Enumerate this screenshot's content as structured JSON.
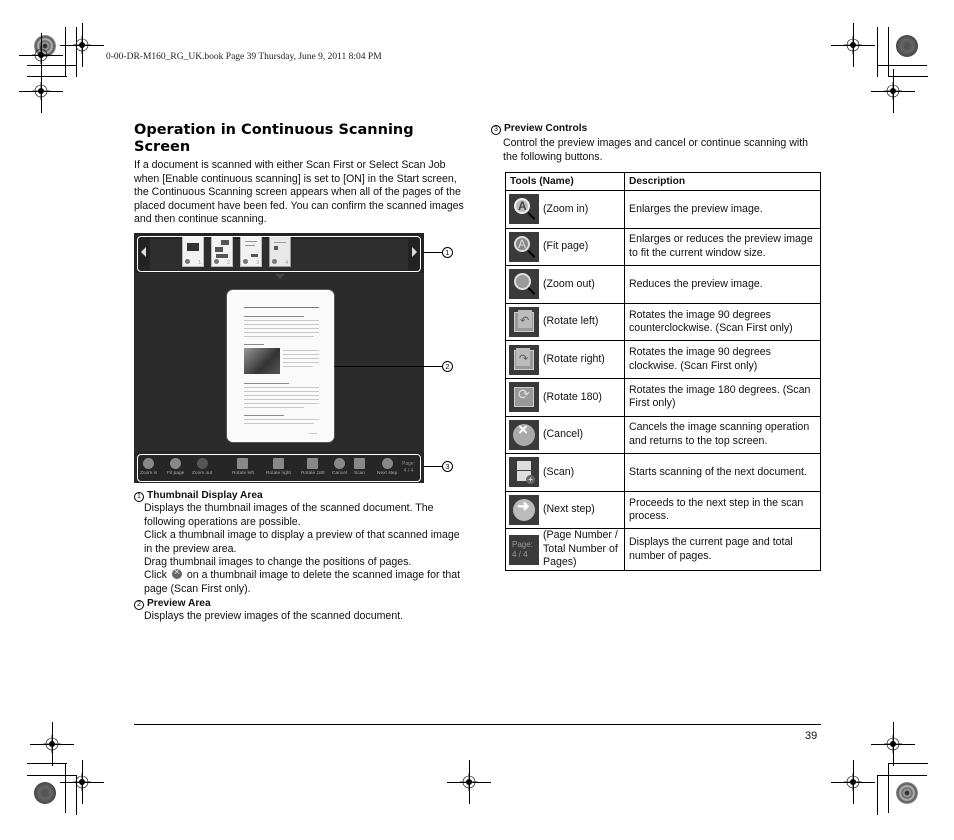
{
  "slug": "0-00-DR-M160_RG_UK.book  Page 39  Thursday, June 9, 2011  8:04 PM",
  "section_title": "Operation in Continuous Scanning Screen",
  "intro": "If a document is scanned with either Scan First or Select Scan Job when [Enable continuous scanning] is set to [ON] in the Start screen, the Continuous Scanning screen appears when all of the pages of the placed document have been fed. You can confirm the scanned images and then continue scanning.",
  "figure": {
    "callouts": [
      "1",
      "2",
      "3"
    ],
    "thumbnails": [
      {
        "page": "1"
      },
      {
        "page": "2"
      },
      {
        "page": "3"
      },
      {
        "page": "4"
      }
    ],
    "toolbar": [
      {
        "label": "Zoom in",
        "icon": "zoom-in-icon"
      },
      {
        "label": "Fit page",
        "icon": "fit-page-icon"
      },
      {
        "label": "Zoom out",
        "icon": "zoom-out-icon"
      },
      {
        "label": "Rotate left",
        "icon": "rotate-left-icon"
      },
      {
        "label": "Rotate right",
        "icon": "rotate-right-icon"
      },
      {
        "label": "Rotate 180",
        "icon": "rotate-180-icon"
      },
      {
        "label": "Cancel",
        "icon": "cancel-icon"
      },
      {
        "label": "Scan",
        "icon": "scan-icon"
      },
      {
        "label": "Next step",
        "icon": "next-step-icon"
      }
    ],
    "page_label": "Page:",
    "page_value": "4 / 4"
  },
  "sections": {
    "thumbnail": {
      "num": "1",
      "title": "Thumbnail Display Area",
      "lines": [
        "Displays the thumbnail images of the scanned document. The following operations are possible.",
        "Click a thumbnail image to display a preview of that scanned image in the preview area.",
        "Drag thumbnail images to change the positions of pages."
      ],
      "click_pre": "Click",
      "click_post": "on a thumbnail image to delete the scanned image for that page (Scan First only)."
    },
    "preview": {
      "num": "2",
      "title": "Preview Area",
      "body": "Displays the preview images of the scanned document."
    },
    "controls": {
      "num": "3",
      "title": "Preview Controls",
      "body": "Control the preview images and cancel or continue scanning with the following buttons."
    }
  },
  "table": {
    "headers": [
      "Tools  (Name)",
      "Description"
    ],
    "rows": [
      {
        "name": "(Zoom in)",
        "desc": "Enlarges the preview image."
      },
      {
        "name": "(Fit page)",
        "desc": "Enlarges or reduces the preview image to fit the current window size."
      },
      {
        "name": "(Zoom out)",
        "desc": "Reduces the preview image."
      },
      {
        "name": "(Rotate left)",
        "desc": "Rotates the image 90 degrees counterclockwise. (Scan First only)"
      },
      {
        "name": "(Rotate right)",
        "desc": "Rotates the image 90 degrees clockwise. (Scan First only)"
      },
      {
        "name": "(Rotate 180)",
        "desc": "Rotates the image 180 degrees. (Scan First only)"
      },
      {
        "name": "(Cancel)",
        "desc": "Cancels the image scanning operation and returns to the top screen."
      },
      {
        "name": "(Scan)",
        "desc": "Starts scanning of the next document."
      },
      {
        "name": "(Next step)",
        "desc": "Proceeds to the next step in the scan process."
      },
      {
        "name": "(Page Number / Total Number of Pages)",
        "desc": "Displays the current page and total number of pages."
      }
    ],
    "page_icon_label": "Page:",
    "page_icon_value": "4 / 4"
  },
  "page_number": "39"
}
